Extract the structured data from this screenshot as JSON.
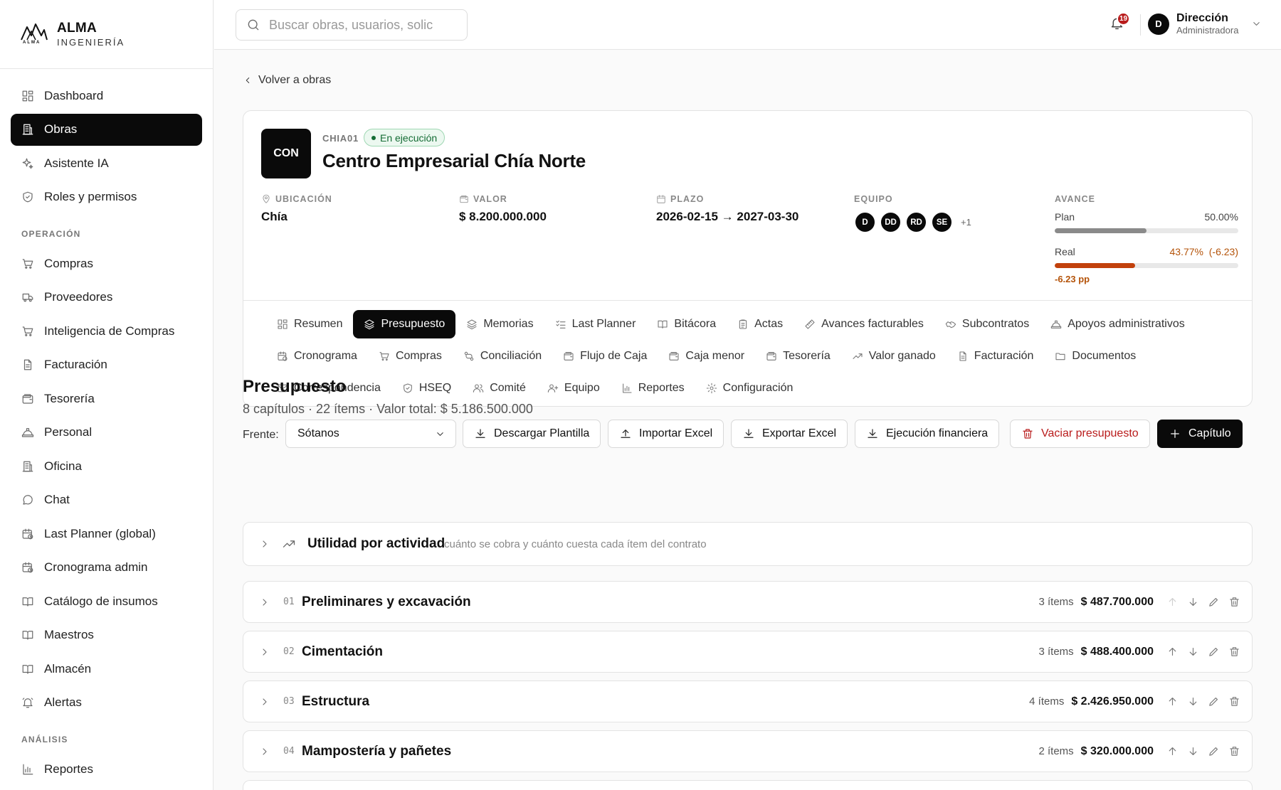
{
  "brand": {
    "name": "ALMA",
    "sub": "INGENIERÍA",
    "logo_text": "ALMA"
  },
  "sidebar": {
    "top_items": [
      {
        "label": "Dashboard",
        "icon": "dashboard-icon"
      },
      {
        "label": "Obras",
        "icon": "building-icon",
        "active": true
      },
      {
        "label": "Asistente IA",
        "icon": "sparkle-icon"
      },
      {
        "label": "Roles y permisos",
        "icon": "shield-icon"
      }
    ],
    "section_operacion": "OPERACIÓN",
    "operacion_items": [
      {
        "label": "Compras",
        "icon": "cart-icon"
      },
      {
        "label": "Proveedores",
        "icon": "truck-icon"
      },
      {
        "label": "Inteligencia de Compras",
        "icon": "cart-icon"
      },
      {
        "label": "Facturación",
        "icon": "document-icon"
      },
      {
        "label": "Tesorería",
        "icon": "wallet-icon"
      },
      {
        "label": "Personal",
        "icon": "hardhat-icon"
      },
      {
        "label": "Oficina",
        "icon": "building-icon"
      },
      {
        "label": "Chat",
        "icon": "chat-icon"
      },
      {
        "label": "Last Planner (global)",
        "icon": "calendar-clock-icon"
      },
      {
        "label": "Cronograma admin",
        "icon": "calendar-clock-icon"
      },
      {
        "label": "Catálogo de insumos",
        "icon": "book-icon"
      },
      {
        "label": "Maestros",
        "icon": "book-icon"
      },
      {
        "label": "Almacén",
        "icon": "book-icon"
      },
      {
        "label": "Alertas",
        "icon": "bell-ring-icon"
      }
    ],
    "section_analisis": "ANÁLISIS",
    "analisis_items": [
      {
        "label": "Reportes",
        "icon": "bar-chart-icon"
      }
    ]
  },
  "topbar": {
    "search_placeholder": "Buscar obras, usuarios, solic",
    "notifications_count": "19",
    "user_initial": "D",
    "user_name": "Dirección",
    "user_role": "Administradora"
  },
  "back_label": "Volver a obras",
  "obra": {
    "code_box": "CON",
    "code": "CHIA01",
    "status": "En ejecución",
    "title": "Centro Empresarial Chía Norte",
    "ubicacion_label": "UBICACIÓN",
    "ubicacion": "Chía",
    "valor_label": "VALOR",
    "valor": "$ 8.200.000.000",
    "plazo_label": "PLAZO",
    "plazo": "2026-02-15 → 2027-03-30",
    "equipo_label": "EQUIPO",
    "equipo": [
      "D",
      "DD",
      "RD",
      "SE"
    ],
    "equipo_more": "+1",
    "avance_label": "AVANCE",
    "plan_label": "Plan",
    "plan_value": "50.00%",
    "plan_fraction": 0.5,
    "real_label": "Real",
    "real_value": "43.77%",
    "real_delta": "(-6.23)",
    "real_fraction": 0.4377,
    "pp_label": "-6.23 pp",
    "colors": {
      "plan_bar": "#8a8a8a",
      "real_bar": "#c2410c",
      "status_green": "#146c34"
    }
  },
  "tabs": [
    [
      {
        "label": "Resumen",
        "icon": "dashboard-icon"
      },
      {
        "label": "Presupuesto",
        "icon": "layers-icon",
        "active": true
      },
      {
        "label": "Memorias",
        "icon": "layers-icon"
      },
      {
        "label": "Last Planner",
        "icon": "checklist-icon"
      },
      {
        "label": "Bitácora",
        "icon": "book-icon"
      },
      {
        "label": "Actas",
        "icon": "clipboard-icon"
      },
      {
        "label": "Avances facturables",
        "icon": "ruler-icon"
      },
      {
        "label": "Subcontratos",
        "icon": "handshake-icon"
      },
      {
        "label": "Apoyos administrativos",
        "icon": "hardhat-icon"
      }
    ],
    [
      {
        "label": "Cronograma",
        "icon": "calendar-clock-icon"
      },
      {
        "label": "Compras",
        "icon": "cart-icon"
      },
      {
        "label": "Conciliación",
        "icon": "git-compare-icon"
      },
      {
        "label": "Flujo de Caja",
        "icon": "wallet-icon"
      },
      {
        "label": "Caja menor",
        "icon": "wallet-icon"
      },
      {
        "label": "Tesorería",
        "icon": "wallet-icon"
      },
      {
        "label": "Valor ganado",
        "icon": "trending-up-icon"
      },
      {
        "label": "Facturación",
        "icon": "document-icon"
      },
      {
        "label": "Documentos",
        "icon": "folder-icon"
      }
    ],
    [
      {
        "label": "Correspondencia",
        "icon": "mail-icon"
      },
      {
        "label": "HSEQ",
        "icon": "shield-icon"
      },
      {
        "label": "Comité",
        "icon": "users-icon"
      },
      {
        "label": "Equipo",
        "icon": "user-plus-icon"
      },
      {
        "label": "Reportes",
        "icon": "bar-chart-icon"
      },
      {
        "label": "Configuración",
        "icon": "gear-icon"
      }
    ]
  ],
  "presupuesto": {
    "title": "Presupuesto",
    "subtitle": "8 capítulos · 22 ítems · Valor total: $ 5.186.500.000",
    "frente_label": "Frente:",
    "frente_selected": "Sótanos",
    "buttons": {
      "descargar": "Descargar Plantilla",
      "importar": "Importar Excel",
      "exportar": "Exportar Excel",
      "ejecucion": "Ejecución financiera",
      "vaciar": "Vaciar presupuesto",
      "capitulo": "Capítulo"
    },
    "utilidad_title": "Utilidad por actividad",
    "utilidad_desc": "cuánto se cobra y cuánto cuesta cada ítem del contrato",
    "capitulos": [
      {
        "num": "01",
        "title": "Preliminares y excavación",
        "count": "3 ítems",
        "value": "$ 487.700.000"
      },
      {
        "num": "02",
        "title": "Cimentación",
        "count": "3 ítems",
        "value": "$ 488.400.000"
      },
      {
        "num": "03",
        "title": "Estructura",
        "count": "4 ítems",
        "value": "$ 2.426.950.000"
      },
      {
        "num": "04",
        "title": "Mampostería y pañetes",
        "count": "2 ítems",
        "value": "$ 320.000.000"
      }
    ]
  }
}
